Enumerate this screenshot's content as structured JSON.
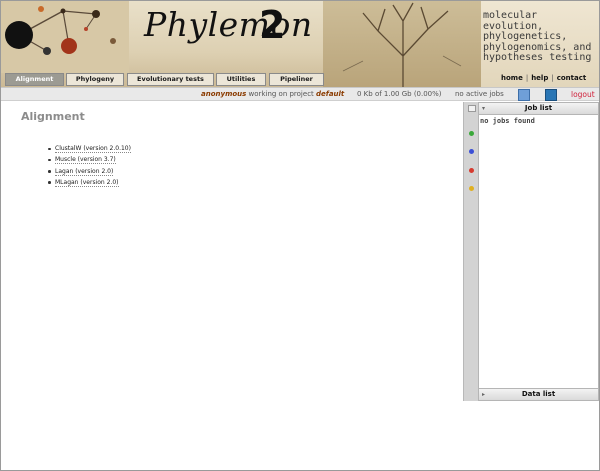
{
  "header": {
    "logo_word": "Phylemon",
    "logo_digit": "2",
    "tagline": [
      "molecular evolution,",
      "phylogenetics,",
      "phylogenomics, and",
      "hypotheses testing"
    ],
    "toplinks": [
      "home",
      "help",
      "contact"
    ]
  },
  "tabs": [
    {
      "label": "Alignment",
      "active": true
    },
    {
      "label": "Phylogeny",
      "active": false
    },
    {
      "label": "Evolutionary tests",
      "active": false
    },
    {
      "label": "Utilities",
      "active": false
    },
    {
      "label": "Pipeliner",
      "active": false
    }
  ],
  "status": {
    "user": "anonymous",
    "working_text": " working on project ",
    "project": "default",
    "quota": "0 Kb of 1.00 Gb (0.00%)",
    "jobs": "no active jobs",
    "logout": "logout"
  },
  "main": {
    "title": "Alignment",
    "tools": [
      "ClustalW (version 2.0.10)",
      "Muscle (version 3.7)",
      "Lagan (version 2.0)",
      "MLagan (version 2.0)"
    ]
  },
  "job_panel": {
    "title": "Job list",
    "empty_text": "no jobs found",
    "data_title": "Data list"
  },
  "colors": {
    "dot_colors": [
      "#3aa83a",
      "#3b4fd6",
      "#d63a2e",
      "#e0b020"
    ]
  },
  "icons": {
    "status_icon_1": "open-folder-icon",
    "status_icon_2": "upload-data-icon"
  }
}
